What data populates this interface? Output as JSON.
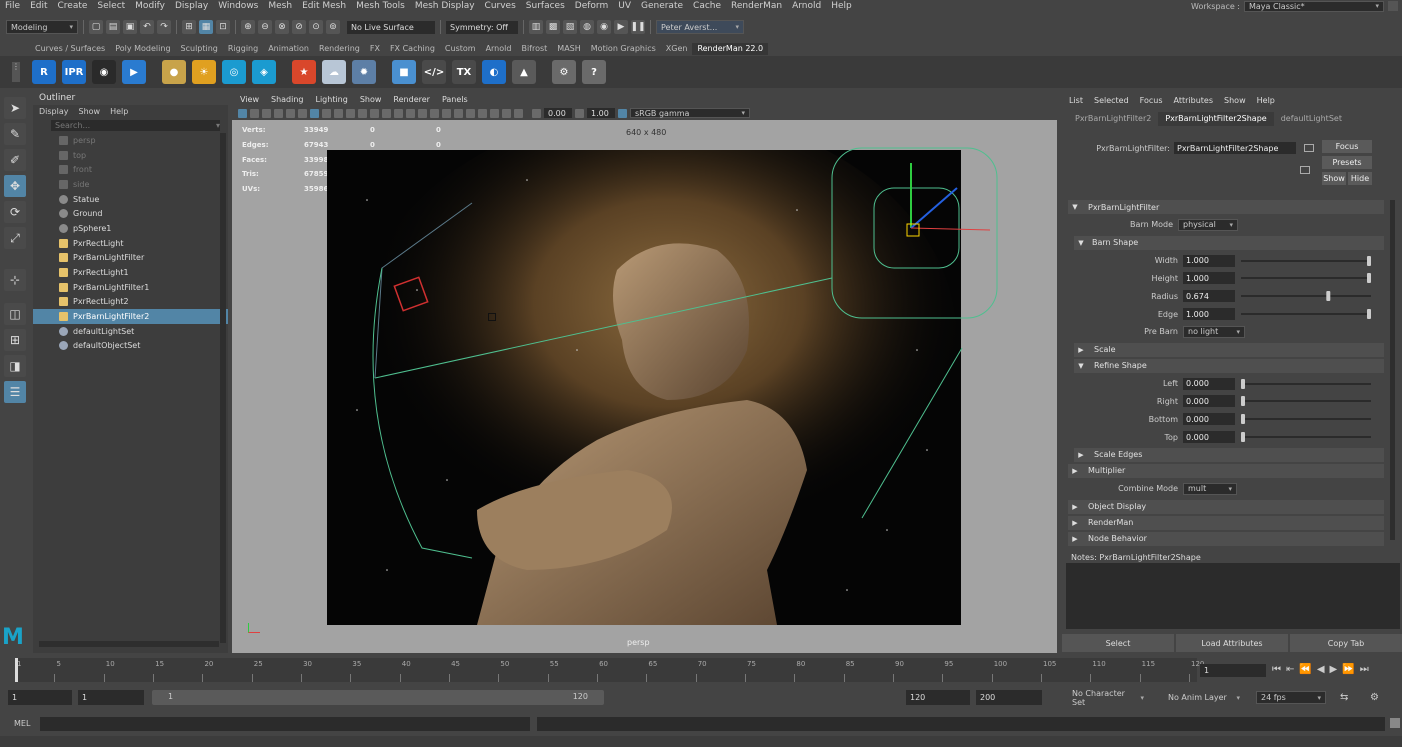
{
  "menubar": {
    "items": [
      "File",
      "Edit",
      "Create",
      "Select",
      "Modify",
      "Display",
      "Windows",
      "Mesh",
      "Edit Mesh",
      "Mesh Tools",
      "Mesh Display",
      "Curves",
      "Surfaces",
      "Deform",
      "UV",
      "Generate",
      "Cache",
      "RenderMan",
      "Arnold",
      "Help"
    ],
    "workspace_label": "Workspace :",
    "workspace_value": "Maya Classic*"
  },
  "statusline": {
    "mode": "Modeling",
    "live_surface": "No Live Surface",
    "symmetry": "Symmetry: Off",
    "user": "Peter Averst..."
  },
  "shelf": {
    "tabs": [
      "Curves / Surfaces",
      "Poly Modeling",
      "Sculpting",
      "Rigging",
      "Animation",
      "Rendering",
      "FX",
      "FX Caching",
      "Custom",
      "Arnold",
      "Bifrost",
      "MASH",
      "Motion Graphics",
      "XGen",
      "RenderMan 22.0"
    ],
    "active_tab": "RenderMan 22.0",
    "icons": [
      {
        "name": "render-icon",
        "text": "R",
        "color": "#1e6fc9"
      },
      {
        "name": "ipr-icon",
        "text": "IPR",
        "color": "#1e6fc9"
      },
      {
        "name": "camera-icon",
        "text": "◉",
        "color": "#2a2a2a"
      },
      {
        "name": "clapper-icon",
        "text": "▶",
        "color": "#2a7bd0"
      },
      {
        "name": "sphere-light-icon",
        "text": "●",
        "color": "#c8a34a"
      },
      {
        "name": "sun-light-icon",
        "text": "☀",
        "color": "#e0a020"
      },
      {
        "name": "dome-light-icon",
        "text": "◎",
        "color": "#1b9bd0"
      },
      {
        "name": "portal-light-icon",
        "text": "◈",
        "color": "#1b9bd0"
      },
      {
        "name": "star-material-icon",
        "text": "★",
        "color": "#d9472b"
      },
      {
        "name": "cloud-icon",
        "text": "☁",
        "color": "#b8c6d6"
      },
      {
        "name": "gear-material-icon",
        "text": "✹",
        "color": "#5d7fa6"
      },
      {
        "name": "cube-icon",
        "text": "■",
        "color": "#4a90d0"
      },
      {
        "name": "code-icon",
        "text": "</>",
        "color": "#4a4a4a"
      },
      {
        "name": "texture-icon",
        "text": "TX",
        "color": "#4a4a4a"
      },
      {
        "name": "moon-icon",
        "text": "◐",
        "color": "#1e6fc9"
      },
      {
        "name": "histogram-icon",
        "text": "▲",
        "color": "#5a5a5a"
      },
      {
        "name": "plug-icon",
        "text": "⚙",
        "color": "#6a6a6a"
      },
      {
        "name": "help-icon",
        "text": "?",
        "color": "#6a6a6a"
      }
    ]
  },
  "outliner": {
    "title": "Outliner",
    "menu": [
      "Display",
      "Show",
      "Help"
    ],
    "search_placeholder": "Search...",
    "items": [
      {
        "label": "persp",
        "type": "camera",
        "dim": true
      },
      {
        "label": "top",
        "type": "camera",
        "dim": true
      },
      {
        "label": "front",
        "type": "camera",
        "dim": true
      },
      {
        "label": "side",
        "type": "camera",
        "dim": true
      },
      {
        "label": "Statue",
        "type": "mesh",
        "dim": false
      },
      {
        "label": "Ground",
        "type": "mesh",
        "dim": false
      },
      {
        "label": "pSphere1",
        "type": "mesh",
        "dim": false
      },
      {
        "label": "PxrRectLight",
        "type": "light",
        "dim": false
      },
      {
        "label": "PxrBarnLightFilter",
        "type": "light",
        "dim": false
      },
      {
        "label": "PxrRectLight1",
        "type": "light",
        "dim": false
      },
      {
        "label": "PxrBarnLightFilter1",
        "type": "light",
        "dim": false
      },
      {
        "label": "PxrRectLight2",
        "type": "light",
        "dim": false
      },
      {
        "label": "PxrBarnLightFilter2",
        "type": "light",
        "dim": false,
        "selected": true
      },
      {
        "label": "defaultLightSet",
        "type": "set",
        "dim": false
      },
      {
        "label": "defaultObjectSet",
        "type": "set",
        "dim": false
      }
    ]
  },
  "viewport": {
    "menu": [
      "View",
      "Shading",
      "Lighting",
      "Show",
      "Renderer",
      "Panels"
    ],
    "exposure": "0.00",
    "gamma": "1.00",
    "colorspace": "sRGB gamma",
    "resolution": "640 x 480",
    "camera": "persp",
    "hud": [
      {
        "k": "Verts:",
        "a": "33949",
        "b": "0",
        "c": "0"
      },
      {
        "k": "Edges:",
        "a": "67943",
        "b": "0",
        "c": "0"
      },
      {
        "k": "Faces:",
        "a": "33998",
        "b": "0",
        "c": "0"
      },
      {
        "k": "Tris:",
        "a": "67859",
        "b": "0",
        "c": "0"
      },
      {
        "k": "UVs:",
        "a": "35986",
        "b": "0",
        "c": "0"
      }
    ]
  },
  "attribute_editor": {
    "menu": [
      "List",
      "Selected",
      "Focus",
      "Attributes",
      "Show",
      "Help"
    ],
    "tabs": [
      "PxrBarnLightFilter2",
      "PxrBarnLightFilter2Shape",
      "defaultLightSet"
    ],
    "active_tab": "PxrBarnLightFilter2Shape",
    "node_label": "PxrBarnLightFilter:",
    "node_value": "PxrBarnLightFilter2Shape",
    "buttons": {
      "focus": "Focus",
      "presets": "Presets",
      "show": "Show",
      "hide": "Hide"
    },
    "section_main": "PxrBarnLightFilter",
    "barn_mode_label": "Barn Mode",
    "barn_mode_value": "physical",
    "section_barn_shape": "Barn Shape",
    "barn_shape": [
      {
        "label": "Width",
        "value": "1.000",
        "pos": 1.0
      },
      {
        "label": "Height",
        "value": "1.000",
        "pos": 1.0
      },
      {
        "label": "Radius",
        "value": "0.674",
        "pos": 0.674
      },
      {
        "label": "Edge",
        "value": "1.000",
        "pos": 1.0
      }
    ],
    "pre_barn_label": "Pre Barn",
    "pre_barn_value": "no light",
    "section_scale": "Scale",
    "section_refine": "Refine Shape",
    "refine": [
      {
        "label": "Left",
        "value": "0.000",
        "pos": 0
      },
      {
        "label": "Right",
        "value": "0.000",
        "pos": 0
      },
      {
        "label": "Bottom",
        "value": "0.000",
        "pos": 0
      },
      {
        "label": "Top",
        "value": "0.000",
        "pos": 0
      }
    ],
    "section_scale_edges": "Scale Edges",
    "section_multiplier": "Multiplier",
    "combine_mode_label": "Combine Mode",
    "combine_mode_value": "mult",
    "section_object_display": "Object Display",
    "section_renderman": "RenderMan",
    "section_node_behavior": "Node Behavior",
    "notes_label": "Notes:",
    "notes_value": "PxrBarnLightFilter2Shape",
    "bottom_buttons": [
      "Select",
      "Load Attributes",
      "Copy Tab"
    ]
  },
  "timeline": {
    "ticks": [
      "1",
      "5",
      "10",
      "15",
      "20",
      "25",
      "30",
      "35",
      "40",
      "45",
      "50",
      "55",
      "60",
      "65",
      "70",
      "75",
      "80",
      "85",
      "90",
      "95",
      "100",
      "105",
      "110",
      "115",
      "120"
    ],
    "current_frame": "1"
  },
  "range": {
    "start": "1",
    "anim_start": "1",
    "slider_start": "1",
    "slider_end": "120",
    "anim_end": "120",
    "end": "200",
    "character_set": "No Character Set",
    "anim_layer": "No Anim Layer",
    "fps": "24 fps"
  },
  "command": {
    "label": "MEL"
  }
}
